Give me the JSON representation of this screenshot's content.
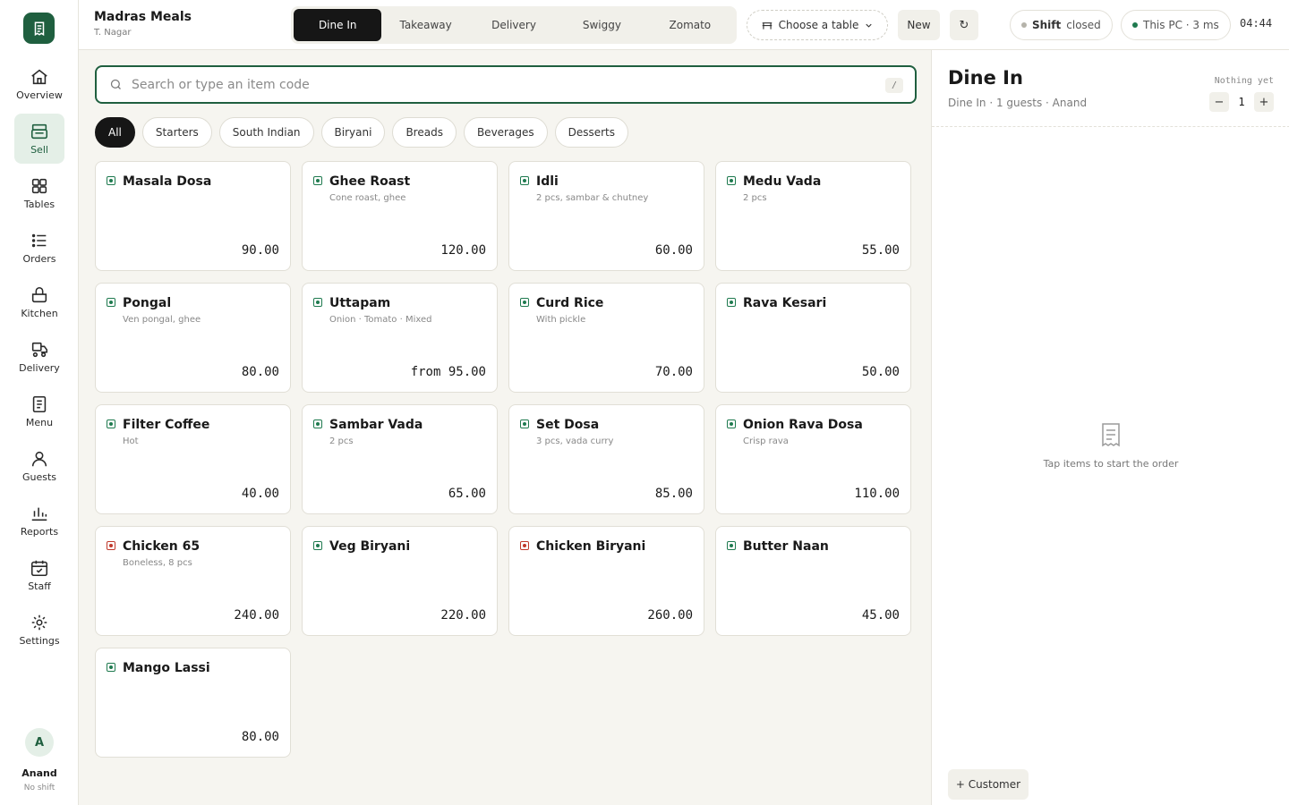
{
  "sidebar": {
    "logo_icon": "receipt-icon",
    "items": [
      {
        "label": "Overview",
        "icon": "home-icon",
        "active": false
      },
      {
        "label": "Sell",
        "icon": "register-icon",
        "active": true
      },
      {
        "label": "Tables",
        "icon": "grid-icon",
        "active": false
      },
      {
        "label": "Orders",
        "icon": "list-icon",
        "active": false
      },
      {
        "label": "Kitchen",
        "icon": "pot-icon",
        "active": false
      },
      {
        "label": "Delivery",
        "icon": "scooter-icon",
        "active": false
      },
      {
        "label": "Menu",
        "icon": "document-icon",
        "active": false
      },
      {
        "label": "Guests",
        "icon": "person-icon",
        "active": false
      },
      {
        "label": "Reports",
        "icon": "bar-chart-icon",
        "active": false
      },
      {
        "label": "Staff",
        "icon": "calendar-check-icon",
        "active": false
      },
      {
        "label": "Settings",
        "icon": "gear-icon",
        "active": false
      }
    ],
    "user": {
      "initial": "A",
      "name": "Anand",
      "shift": "No shift"
    }
  },
  "header": {
    "brand_name": "Madras Meals",
    "brand_location": "T. Nagar",
    "modes": [
      "Dine In",
      "Takeaway",
      "Delivery",
      "Swiggy",
      "Zomato"
    ],
    "active_mode": "Dine In",
    "table_picker": "Choose a table",
    "new_label": "New",
    "refresh_glyph": "↻",
    "shift_label": "Shift",
    "shift_status": "closed",
    "device_status": "This PC · 3 ms",
    "clock": "04:44"
  },
  "search": {
    "placeholder": "Search or type an item code",
    "shortcut": "/"
  },
  "categories": [
    "All",
    "Starters",
    "South Indian",
    "Biryani",
    "Breads",
    "Beverages",
    "Desserts"
  ],
  "active_category": "All",
  "items": [
    {
      "name": "Masala Dosa",
      "desc": "",
      "price": "90.00",
      "veg": true
    },
    {
      "name": "Ghee Roast",
      "desc": "Cone roast, ghee",
      "price": "120.00",
      "veg": true
    },
    {
      "name": "Idli",
      "desc": "2 pcs, sambar & chutney",
      "price": "60.00",
      "veg": true
    },
    {
      "name": "Medu Vada",
      "desc": "2 pcs",
      "price": "55.00",
      "veg": true
    },
    {
      "name": "Pongal",
      "desc": "Ven pongal, ghee",
      "price": "80.00",
      "veg": true
    },
    {
      "name": "Uttapam",
      "desc": "Onion · Tomato · Mixed",
      "price": "from 95.00",
      "veg": true
    },
    {
      "name": "Curd Rice",
      "desc": "With pickle",
      "price": "70.00",
      "veg": true
    },
    {
      "name": "Rava Kesari",
      "desc": "",
      "price": "50.00",
      "veg": true
    },
    {
      "name": "Filter Coffee",
      "desc": "Hot",
      "price": "40.00",
      "veg": true
    },
    {
      "name": "Sambar Vada",
      "desc": "2 pcs",
      "price": "65.00",
      "veg": true
    },
    {
      "name": "Set Dosa",
      "desc": "3 pcs, vada curry",
      "price": "85.00",
      "veg": true
    },
    {
      "name": "Onion Rava Dosa",
      "desc": "Crisp rava",
      "price": "110.00",
      "veg": true
    },
    {
      "name": "Chicken 65",
      "desc": "Boneless, 8 pcs",
      "price": "240.00",
      "veg": false
    },
    {
      "name": "Veg Biryani",
      "desc": "",
      "price": "220.00",
      "veg": true
    },
    {
      "name": "Chicken Biryani",
      "desc": "",
      "price": "260.00",
      "veg": false
    },
    {
      "name": "Butter Naan",
      "desc": "",
      "price": "45.00",
      "veg": true
    },
    {
      "name": "Mango Lassi",
      "desc": "",
      "price": "80.00",
      "veg": true
    }
  ],
  "order": {
    "title": "Dine In",
    "subtitle": "Dine In · 1 guests · Anand",
    "status": "Nothing yet",
    "guests": "1",
    "minus": "−",
    "plus": "+",
    "empty_text": "Tap items to start the order",
    "customer_button": "+ Customer"
  },
  "colors": {
    "accent": "#1f5f3f",
    "veg": "#1f7a4f",
    "nonveg": "#c0392b",
    "status_ok": "#1f7a4f"
  }
}
